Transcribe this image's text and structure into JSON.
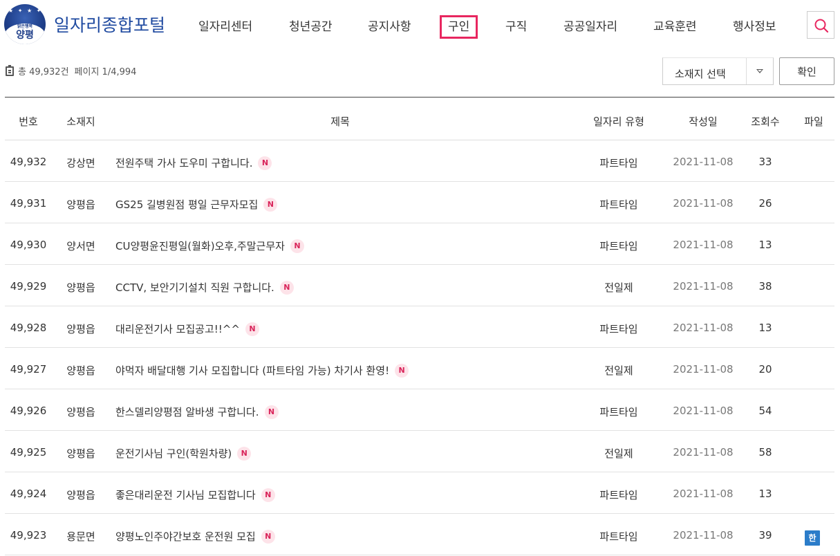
{
  "header": {
    "logo_small": "맑은행복",
    "logo_big": "양평",
    "site_title": "일자리종합포털",
    "nav": [
      "일자리센터",
      "청년공간",
      "공지사항",
      "구인",
      "구직",
      "공공일자리",
      "교육훈련",
      "행사정보"
    ],
    "active_nav": "구인"
  },
  "info": {
    "total": "총 49,932건",
    "page": "페이지 1/4,994"
  },
  "filter": {
    "select_label": "소재지 선택",
    "confirm_label": "확인"
  },
  "table": {
    "headers": [
      "번호",
      "소재지",
      "제목",
      "일자리 유형",
      "작성일",
      "조회수",
      "파일"
    ],
    "new_badge": "N",
    "file_badge": "한",
    "rows": [
      {
        "no": "49,932",
        "loc": "강상면",
        "title": "전원주택 가사 도우미 구합니다.",
        "type": "파트타임",
        "date": "2021-11-08",
        "views": "33",
        "file": false
      },
      {
        "no": "49,931",
        "loc": "양평읍",
        "title": "GS25 길병원점 평일 근무자모집",
        "type": "파트타임",
        "date": "2021-11-08",
        "views": "26",
        "file": false
      },
      {
        "no": "49,930",
        "loc": "양서면",
        "title": "CU양평윤진평일(월화)오후,주말근무자",
        "type": "파트타임",
        "date": "2021-11-08",
        "views": "13",
        "file": false
      },
      {
        "no": "49,929",
        "loc": "양평읍",
        "title": "CCTV, 보안기기설치 직원 구합니다.",
        "type": "전일제",
        "date": "2021-11-08",
        "views": "38",
        "file": false
      },
      {
        "no": "49,928",
        "loc": "양평읍",
        "title": "대리운전기사 모집공고!!^^",
        "type": "파트타임",
        "date": "2021-11-08",
        "views": "13",
        "file": false
      },
      {
        "no": "49,927",
        "loc": "양평읍",
        "title": "야먹자 배달대행 기사 모집합니다 (파트타임 가능) 차기사 환영!",
        "type": "전일제",
        "date": "2021-11-08",
        "views": "20",
        "file": false
      },
      {
        "no": "49,926",
        "loc": "양평읍",
        "title": "한스델리양평점 알바생 구합니다.",
        "type": "파트타임",
        "date": "2021-11-08",
        "views": "54",
        "file": false
      },
      {
        "no": "49,925",
        "loc": "양평읍",
        "title": "운전기사님 구인(학원차량)",
        "type": "전일제",
        "date": "2021-11-08",
        "views": "58",
        "file": false
      },
      {
        "no": "49,924",
        "loc": "양평읍",
        "title": "좋은대리운전 기사님 모집합니다",
        "type": "파트타임",
        "date": "2021-11-08",
        "views": "13",
        "file": false
      },
      {
        "no": "49,923",
        "loc": "용문면",
        "title": "양평노인주야간보호 운전원 모집",
        "type": "파트타임",
        "date": "2021-11-08",
        "views": "39",
        "file": true
      }
    ]
  }
}
